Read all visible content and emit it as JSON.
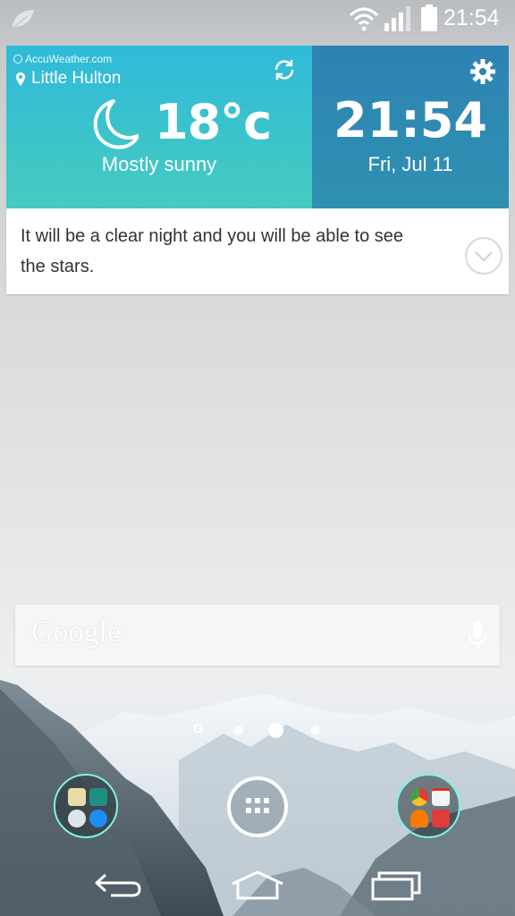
{
  "status_bar": {
    "time": "21:54",
    "icons": [
      "leaf-icon",
      "wifi-icon",
      "signal-icon",
      "battery-icon"
    ]
  },
  "weather_widget": {
    "provider": "AccuWeather.com",
    "location": "Little Hulton",
    "temperature": "18°c",
    "condition": "Mostly sunny",
    "clock": "21:54",
    "date": "Fri, Jul 11",
    "forecast": "It will be a clear night and you will be able to see the stars.",
    "colors": {
      "accent_left": "#2fbad9",
      "accent_right": "#2d83b4"
    }
  },
  "search_bar": {
    "logo": "Google"
  },
  "pager": {
    "label": "G",
    "pages": 4,
    "current": 3
  },
  "dock": {
    "left_folder_apps": [
      "messaging-icon",
      "phone-icon",
      "contacts-icon",
      "messenger-icon"
    ],
    "right_folder_apps": [
      "chrome-icon",
      "gmail-icon",
      "play-music-icon",
      "maps-icon"
    ],
    "center": "apps-drawer-icon"
  },
  "nav_bar": [
    "back-icon",
    "home-icon",
    "recents-icon"
  ]
}
